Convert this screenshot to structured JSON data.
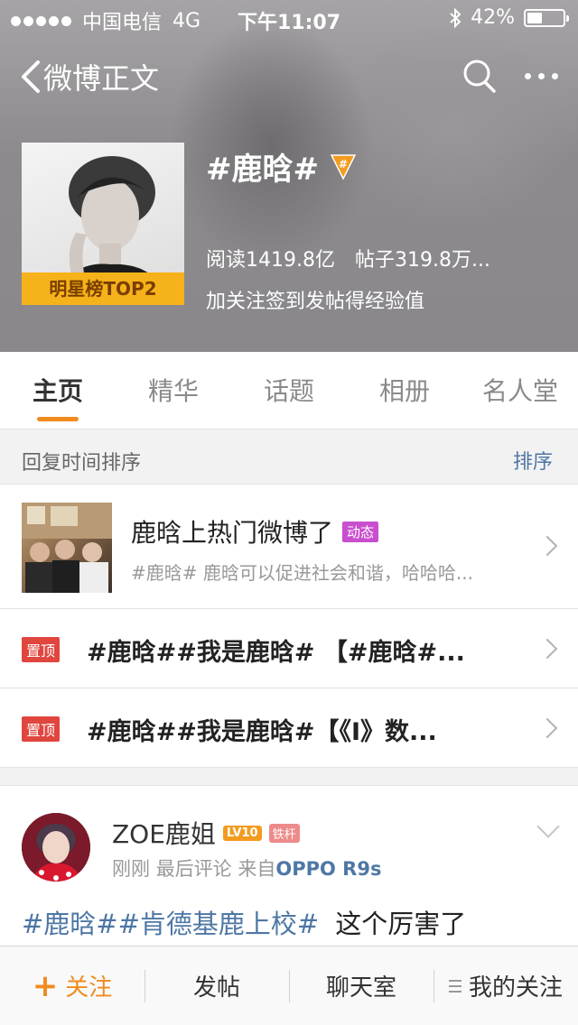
{
  "status_bar": {
    "carrier": "中国电信",
    "network": "4G",
    "time": "下午11:07",
    "battery": "42%",
    "battery_level": 0.42
  },
  "nav": {
    "back_label": "微博正文",
    "search_icon": "search-icon",
    "more_icon": "more-icon"
  },
  "topic": {
    "cover_badge": "明星榜TOP2",
    "title": "#鹿晗#",
    "read_count": "阅读1419.8亿",
    "post_count": "帖子319.8万...",
    "hint": "加关注签到发帖得经验值",
    "badge_icon": "topic-hash-badge-icon"
  },
  "tabs": [
    {
      "label": "主页",
      "active": true
    },
    {
      "label": "精华",
      "active": false
    },
    {
      "label": "话题",
      "active": false
    },
    {
      "label": "相册",
      "active": false
    },
    {
      "label": "名人堂",
      "active": false
    }
  ],
  "sort": {
    "label": "回复时间排序",
    "button": "排序"
  },
  "feature": {
    "title": "鹿晗上热门微博了",
    "tag": "动态",
    "subtitle": "#鹿晗# 鹿晗可以促进社会和谐，哈哈哈..."
  },
  "pinned": [
    {
      "badge": "置顶",
      "text": "#鹿晗##我是鹿晗# 【#鹿晗#..."
    },
    {
      "badge": "置顶",
      "text": "#鹿晗##我是鹿晗#【《I》数..."
    }
  ],
  "post": {
    "user_name": "ZOE鹿姐",
    "level_badge": "LV10",
    "fan_badge": "铁杆",
    "time": "刚刚",
    "meta_label": "最后评论",
    "source_prefix": "来自",
    "source": "OPPO R9s",
    "hashtags": "#鹿晗##肯德基鹿上校#",
    "text": "这个厉害了"
  },
  "bottom_bar": {
    "follow": "关注",
    "post": "发帖",
    "chat": "聊天室",
    "my_follow": "我的关注"
  },
  "colors": {
    "accent_orange": "#f08b1f",
    "link_blue": "#4e77a5",
    "pin_red": "#e0453e",
    "dynamic_purple": "#c94fcf"
  }
}
